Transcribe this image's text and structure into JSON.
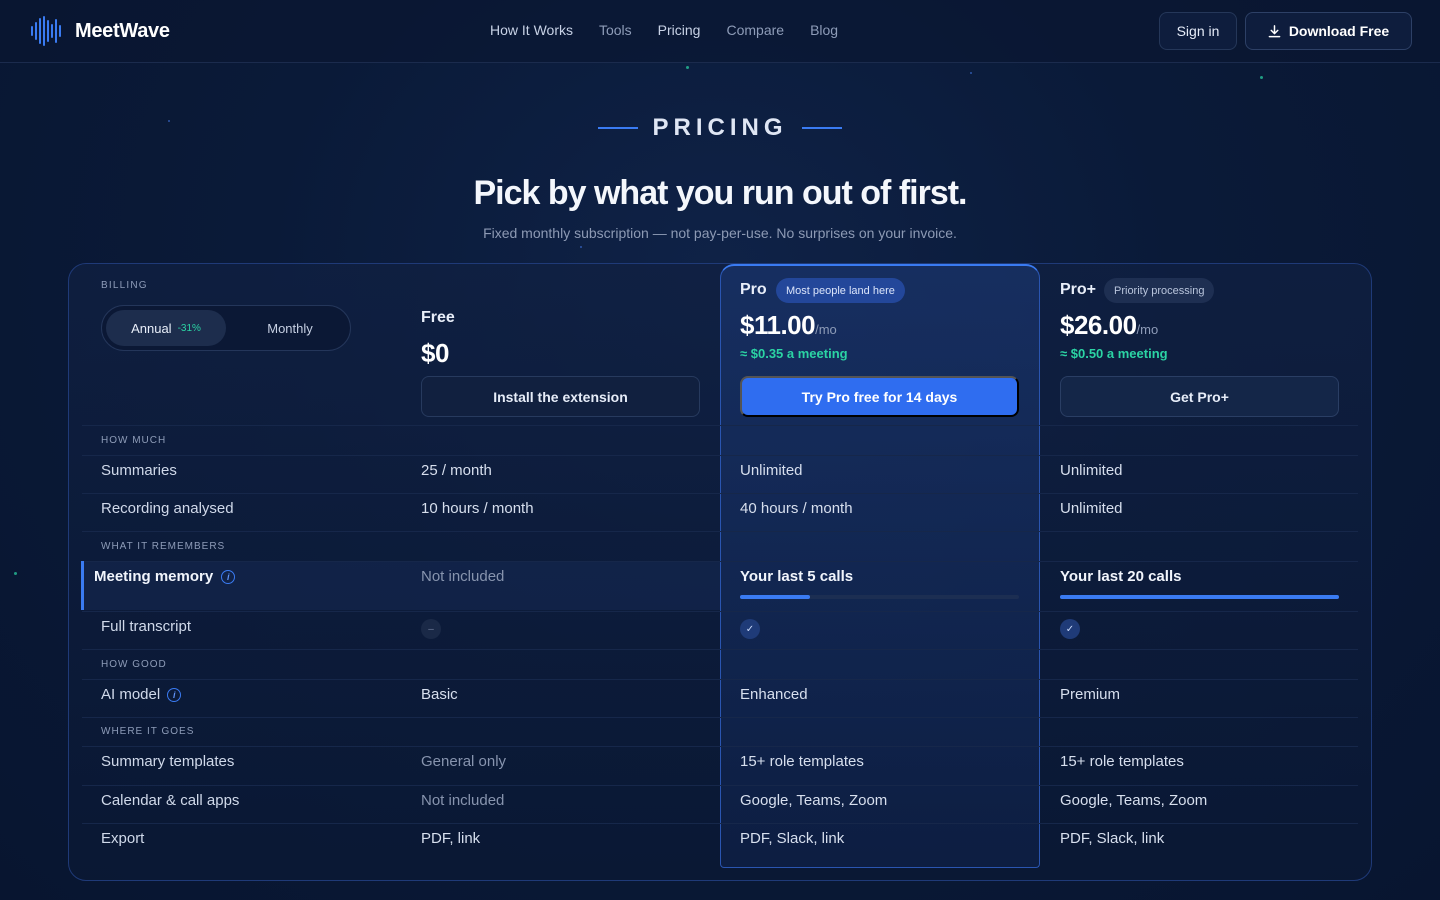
{
  "brand": {
    "name": "MeetWave",
    "icon": "soundwave-icon"
  },
  "nav": {
    "links": [
      "How It Works",
      "Tools",
      "Pricing",
      "Compare",
      "Blog"
    ],
    "sign_in": "Sign in",
    "download": "Download Free",
    "download_icon": "download-icon"
  },
  "hero": {
    "eyebrow": "PRICING",
    "title": "Pick by what you run out of first.",
    "subtitle": "Fixed monthly subscription — not pay-per-use. No surprises on your invoice."
  },
  "billing": {
    "label": "BILLING",
    "annual": "Annual",
    "annual_discount": "-31%",
    "monthly": "Monthly",
    "selected": "Annual"
  },
  "plans": {
    "free": {
      "name": "Free",
      "price": "$0",
      "button": "Install the extension"
    },
    "pro": {
      "name": "Pro",
      "badge": "Most people land here",
      "price": "$11.00",
      "per": "/mo",
      "per_meeting": "≈ $0.35 a meeting",
      "button": "Try Pro free for 14 days"
    },
    "proplus": {
      "name": "Pro+",
      "badge": "Priority processing",
      "price": "$26.00",
      "per": "/mo",
      "per_meeting": "≈ $0.50 a meeting",
      "button": "Get Pro+"
    }
  },
  "sections": {
    "how_much": "HOW MUCH",
    "what_it_remembers": "WHAT IT REMEMBERS",
    "how_good": "HOW GOOD",
    "where_it_goes": "WHERE IT GOES"
  },
  "rows": {
    "summaries": {
      "label": "Summaries",
      "free": "25 / month",
      "pro": "Unlimited",
      "proplus": "Unlimited"
    },
    "recording": {
      "label": "Recording analysed",
      "free": "10 hours / month",
      "pro": "40 hours / month",
      "proplus": "Unlimited"
    },
    "memory": {
      "label": "Meeting memory",
      "free": "Not included",
      "pro": "Your last 5 calls",
      "proplus": "Your last 20 calls",
      "pro_fill": 0.25,
      "proplus_fill": 1.0
    },
    "transcript": {
      "label": "Full transcript",
      "free": "–",
      "pro": "✓",
      "proplus": "✓"
    },
    "model": {
      "label": "AI model",
      "free": "Basic",
      "pro": "Enhanced",
      "proplus": "Premium"
    },
    "templates": {
      "label": "Summary templates",
      "free": "General only",
      "pro": "15+ role templates",
      "proplus": "15+ role templates"
    },
    "calendar": {
      "label": "Calendar & call apps",
      "free": "Not included",
      "pro": "Google, Teams, Zoom",
      "proplus": "Google, Teams, Zoom"
    },
    "export": {
      "label": "Export",
      "free": "PDF, link",
      "pro": "PDF, Slack, link",
      "proplus": "PDF, Slack, link"
    }
  },
  "colors": {
    "accent": "#3a7bf2",
    "positive": "#2bd4a4",
    "background": "#0a1a38"
  }
}
